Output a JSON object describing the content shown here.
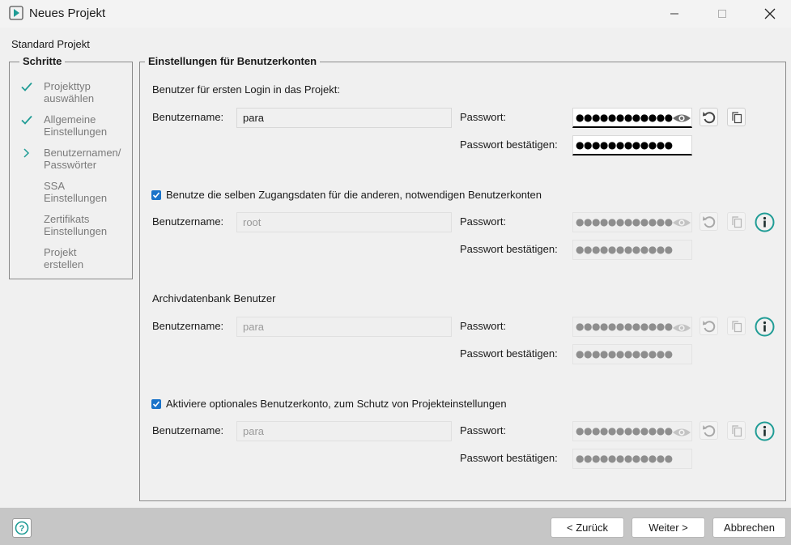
{
  "window": {
    "title": "Neues Projekt",
    "minimize_icon": "minimize-icon",
    "maximize_icon": "maximize-icon",
    "close_icon": "close-icon"
  },
  "subtitle": "Standard Projekt",
  "steps": {
    "legend": "Schritte",
    "items": [
      {
        "line1": "Projekttyp",
        "line2": "auswählen",
        "state": "done"
      },
      {
        "line1": "Allgemeine",
        "line2": "Einstellungen",
        "state": "done"
      },
      {
        "line1": "Benutzernamen/",
        "line2": "Passwörter",
        "state": "current"
      },
      {
        "line1": "SSA",
        "line2": "Einstellungen",
        "state": "pending"
      },
      {
        "line1": "Zertifikats",
        "line2": "Einstellungen",
        "state": "pending"
      },
      {
        "line1": "Projekt",
        "line2": "erstellen",
        "state": "pending"
      }
    ]
  },
  "main": {
    "legend": "Einstellungen für Benutzerkonten",
    "section1": {
      "heading": "Benutzer für ersten Login in das Projekt:",
      "username_label": "Benutzername:",
      "username_value": "para",
      "password_label": "Passwort:",
      "password_value": "●●●●●●●●●●●●",
      "confirm_label": "Passwort bestätigen:",
      "confirm_value": "●●●●●●●●●●●●"
    },
    "section2": {
      "checkbox_label": "Benutze die selben Zugangsdaten für die anderen, notwendigen Benutzerkonten",
      "checked": true,
      "username_label": "Benutzername:",
      "username_value": "root",
      "password_label": "Passwort:",
      "password_value": "●●●●●●●●●●●●",
      "confirm_label": "Passwort bestätigen:",
      "confirm_value": "●●●●●●●●●●●●"
    },
    "section3": {
      "heading": "Archivdatenbank Benutzer",
      "username_label": "Benutzername:",
      "username_value": "para",
      "password_label": "Passwort:",
      "password_value": "●●●●●●●●●●●●",
      "confirm_label": "Passwort bestätigen:",
      "confirm_value": "●●●●●●●●●●●●"
    },
    "section4": {
      "checkbox_label": "Aktiviere optionales Benutzerkonto, zum Schutz von Projekteinstellungen",
      "checked": true,
      "username_label": "Benutzername:",
      "username_value": "para",
      "password_label": "Passwort:",
      "password_value": "●●●●●●●●●●●●",
      "confirm_label": "Passwort bestätigen:",
      "confirm_value": "●●●●●●●●●●●●"
    }
  },
  "footer": {
    "help_icon": "help-icon",
    "back_label": "< Zurück",
    "next_label": "Weiter >",
    "cancel_label": "Abbrechen"
  },
  "colors": {
    "accent_teal": "#1f9c95",
    "checkbox_blue": "#1a73c9",
    "bottom_bar": "#c6c6c6"
  }
}
